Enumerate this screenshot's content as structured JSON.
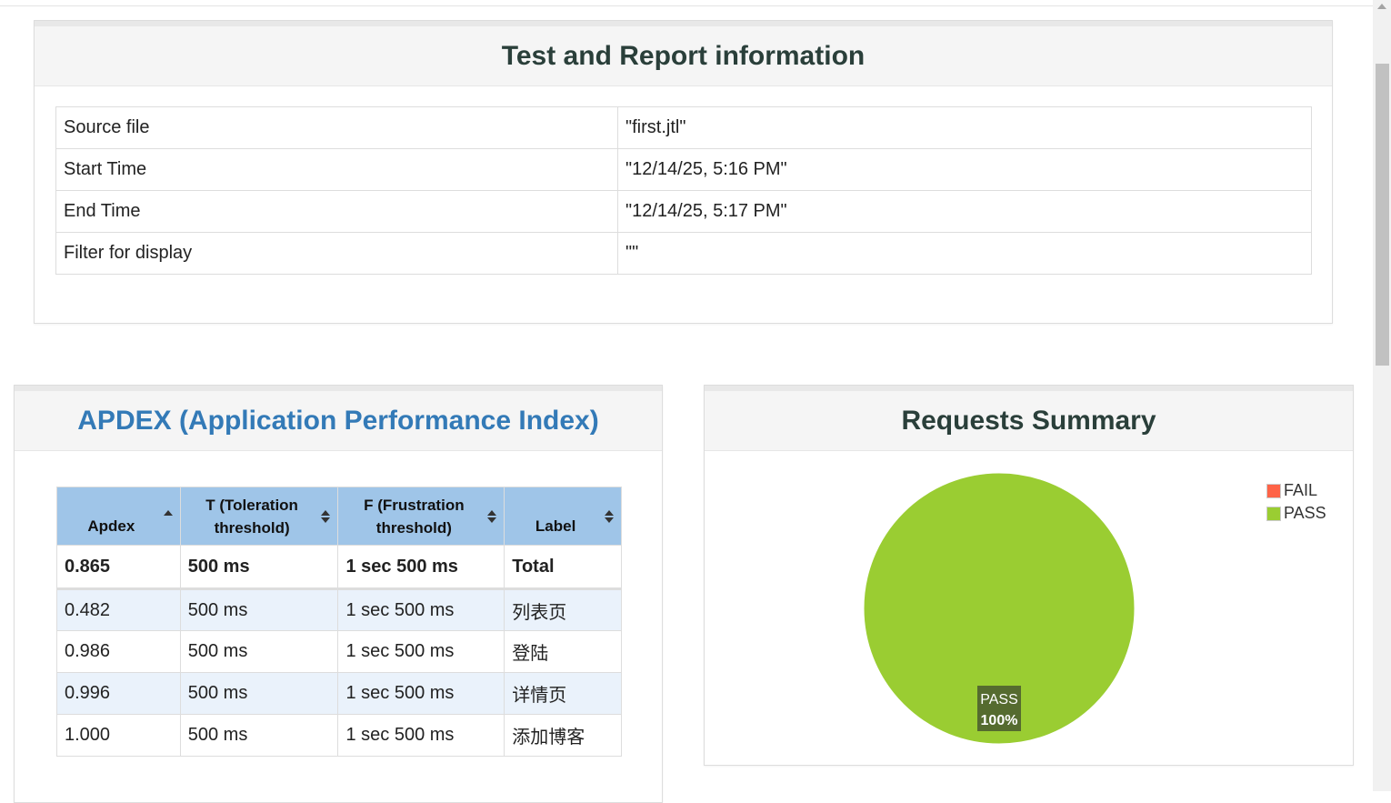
{
  "info": {
    "title": "Test and Report information",
    "rows": [
      {
        "key": "Source file",
        "value": "\"first.jtl\""
      },
      {
        "key": "Start Time",
        "value": "\"12/14/25, 5:16 PM\""
      },
      {
        "key": "End Time",
        "value": "\"12/14/25, 5:17 PM\""
      },
      {
        "key": "Filter for display",
        "value": "\"\""
      }
    ]
  },
  "apdex": {
    "title": "APDEX (Application Performance Index)",
    "headers": {
      "apdex": "Apdex",
      "t_line1": "T (Toleration",
      "t_line2": "threshold)",
      "f_line1": "F (Frustration",
      "f_line2": "threshold)",
      "label": "Label"
    },
    "total": {
      "apdex": "0.865",
      "t": "500 ms",
      "f": "1 sec 500 ms",
      "label": "Total"
    },
    "rows": [
      {
        "apdex": "0.482",
        "t": "500 ms",
        "f": "1 sec 500 ms",
        "label": "列表页"
      },
      {
        "apdex": "0.986",
        "t": "500 ms",
        "f": "1 sec 500 ms",
        "label": "登陆"
      },
      {
        "apdex": "0.996",
        "t": "500 ms",
        "f": "1 sec 500 ms",
        "label": "详情页"
      },
      {
        "apdex": "1.000",
        "t": "500 ms",
        "f": "1 sec 500 ms",
        "label": "添加博客"
      }
    ]
  },
  "summary": {
    "title": "Requests Summary"
  },
  "chart_data": {
    "type": "pie",
    "title": "Requests Summary",
    "series": [
      {
        "name": "FAIL",
        "value": 0,
        "color": "#ff6347"
      },
      {
        "name": "PASS",
        "value": 100,
        "color": "#9acd32"
      }
    ],
    "slice_labels": [
      {
        "name": "PASS",
        "percent": "100%"
      }
    ],
    "legend_position": "top-right"
  }
}
